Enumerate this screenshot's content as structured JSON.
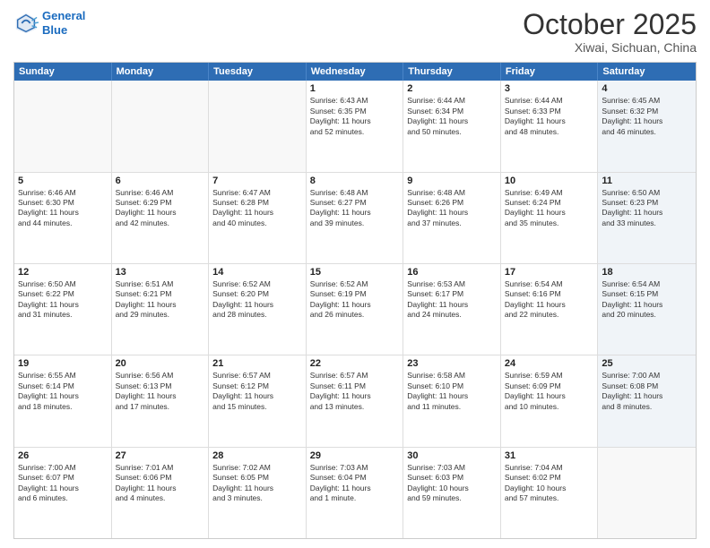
{
  "header": {
    "logo_line1": "General",
    "logo_line2": "Blue",
    "main_title": "October 2025",
    "subtitle": "Xiwai, Sichuan, China"
  },
  "calendar": {
    "days_of_week": [
      "Sunday",
      "Monday",
      "Tuesday",
      "Wednesday",
      "Thursday",
      "Friday",
      "Saturday"
    ],
    "rows": [
      [
        {
          "day": "",
          "text": "",
          "empty": true
        },
        {
          "day": "",
          "text": "",
          "empty": true
        },
        {
          "day": "",
          "text": "",
          "empty": true
        },
        {
          "day": "1",
          "text": "Sunrise: 6:43 AM\nSunset: 6:35 PM\nDaylight: 11 hours\nand 52 minutes."
        },
        {
          "day": "2",
          "text": "Sunrise: 6:44 AM\nSunset: 6:34 PM\nDaylight: 11 hours\nand 50 minutes."
        },
        {
          "day": "3",
          "text": "Sunrise: 6:44 AM\nSunset: 6:33 PM\nDaylight: 11 hours\nand 48 minutes."
        },
        {
          "day": "4",
          "text": "Sunrise: 6:45 AM\nSunset: 6:32 PM\nDaylight: 11 hours\nand 46 minutes.",
          "shaded": true
        }
      ],
      [
        {
          "day": "5",
          "text": "Sunrise: 6:46 AM\nSunset: 6:30 PM\nDaylight: 11 hours\nand 44 minutes."
        },
        {
          "day": "6",
          "text": "Sunrise: 6:46 AM\nSunset: 6:29 PM\nDaylight: 11 hours\nand 42 minutes."
        },
        {
          "day": "7",
          "text": "Sunrise: 6:47 AM\nSunset: 6:28 PM\nDaylight: 11 hours\nand 40 minutes."
        },
        {
          "day": "8",
          "text": "Sunrise: 6:48 AM\nSunset: 6:27 PM\nDaylight: 11 hours\nand 39 minutes."
        },
        {
          "day": "9",
          "text": "Sunrise: 6:48 AM\nSunset: 6:26 PM\nDaylight: 11 hours\nand 37 minutes."
        },
        {
          "day": "10",
          "text": "Sunrise: 6:49 AM\nSunset: 6:24 PM\nDaylight: 11 hours\nand 35 minutes."
        },
        {
          "day": "11",
          "text": "Sunrise: 6:50 AM\nSunset: 6:23 PM\nDaylight: 11 hours\nand 33 minutes.",
          "shaded": true
        }
      ],
      [
        {
          "day": "12",
          "text": "Sunrise: 6:50 AM\nSunset: 6:22 PM\nDaylight: 11 hours\nand 31 minutes."
        },
        {
          "day": "13",
          "text": "Sunrise: 6:51 AM\nSunset: 6:21 PM\nDaylight: 11 hours\nand 29 minutes."
        },
        {
          "day": "14",
          "text": "Sunrise: 6:52 AM\nSunset: 6:20 PM\nDaylight: 11 hours\nand 28 minutes."
        },
        {
          "day": "15",
          "text": "Sunrise: 6:52 AM\nSunset: 6:19 PM\nDaylight: 11 hours\nand 26 minutes."
        },
        {
          "day": "16",
          "text": "Sunrise: 6:53 AM\nSunset: 6:17 PM\nDaylight: 11 hours\nand 24 minutes."
        },
        {
          "day": "17",
          "text": "Sunrise: 6:54 AM\nSunset: 6:16 PM\nDaylight: 11 hours\nand 22 minutes."
        },
        {
          "day": "18",
          "text": "Sunrise: 6:54 AM\nSunset: 6:15 PM\nDaylight: 11 hours\nand 20 minutes.",
          "shaded": true
        }
      ],
      [
        {
          "day": "19",
          "text": "Sunrise: 6:55 AM\nSunset: 6:14 PM\nDaylight: 11 hours\nand 18 minutes."
        },
        {
          "day": "20",
          "text": "Sunrise: 6:56 AM\nSunset: 6:13 PM\nDaylight: 11 hours\nand 17 minutes."
        },
        {
          "day": "21",
          "text": "Sunrise: 6:57 AM\nSunset: 6:12 PM\nDaylight: 11 hours\nand 15 minutes."
        },
        {
          "day": "22",
          "text": "Sunrise: 6:57 AM\nSunset: 6:11 PM\nDaylight: 11 hours\nand 13 minutes."
        },
        {
          "day": "23",
          "text": "Sunrise: 6:58 AM\nSunset: 6:10 PM\nDaylight: 11 hours\nand 11 minutes."
        },
        {
          "day": "24",
          "text": "Sunrise: 6:59 AM\nSunset: 6:09 PM\nDaylight: 11 hours\nand 10 minutes."
        },
        {
          "day": "25",
          "text": "Sunrise: 7:00 AM\nSunset: 6:08 PM\nDaylight: 11 hours\nand 8 minutes.",
          "shaded": true
        }
      ],
      [
        {
          "day": "26",
          "text": "Sunrise: 7:00 AM\nSunset: 6:07 PM\nDaylight: 11 hours\nand 6 minutes."
        },
        {
          "day": "27",
          "text": "Sunrise: 7:01 AM\nSunset: 6:06 PM\nDaylight: 11 hours\nand 4 minutes."
        },
        {
          "day": "28",
          "text": "Sunrise: 7:02 AM\nSunset: 6:05 PM\nDaylight: 11 hours\nand 3 minutes."
        },
        {
          "day": "29",
          "text": "Sunrise: 7:03 AM\nSunset: 6:04 PM\nDaylight: 11 hours\nand 1 minute."
        },
        {
          "day": "30",
          "text": "Sunrise: 7:03 AM\nSunset: 6:03 PM\nDaylight: 10 hours\nand 59 minutes."
        },
        {
          "day": "31",
          "text": "Sunrise: 7:04 AM\nSunset: 6:02 PM\nDaylight: 10 hours\nand 57 minutes."
        },
        {
          "day": "",
          "text": "",
          "empty": true
        }
      ]
    ]
  }
}
